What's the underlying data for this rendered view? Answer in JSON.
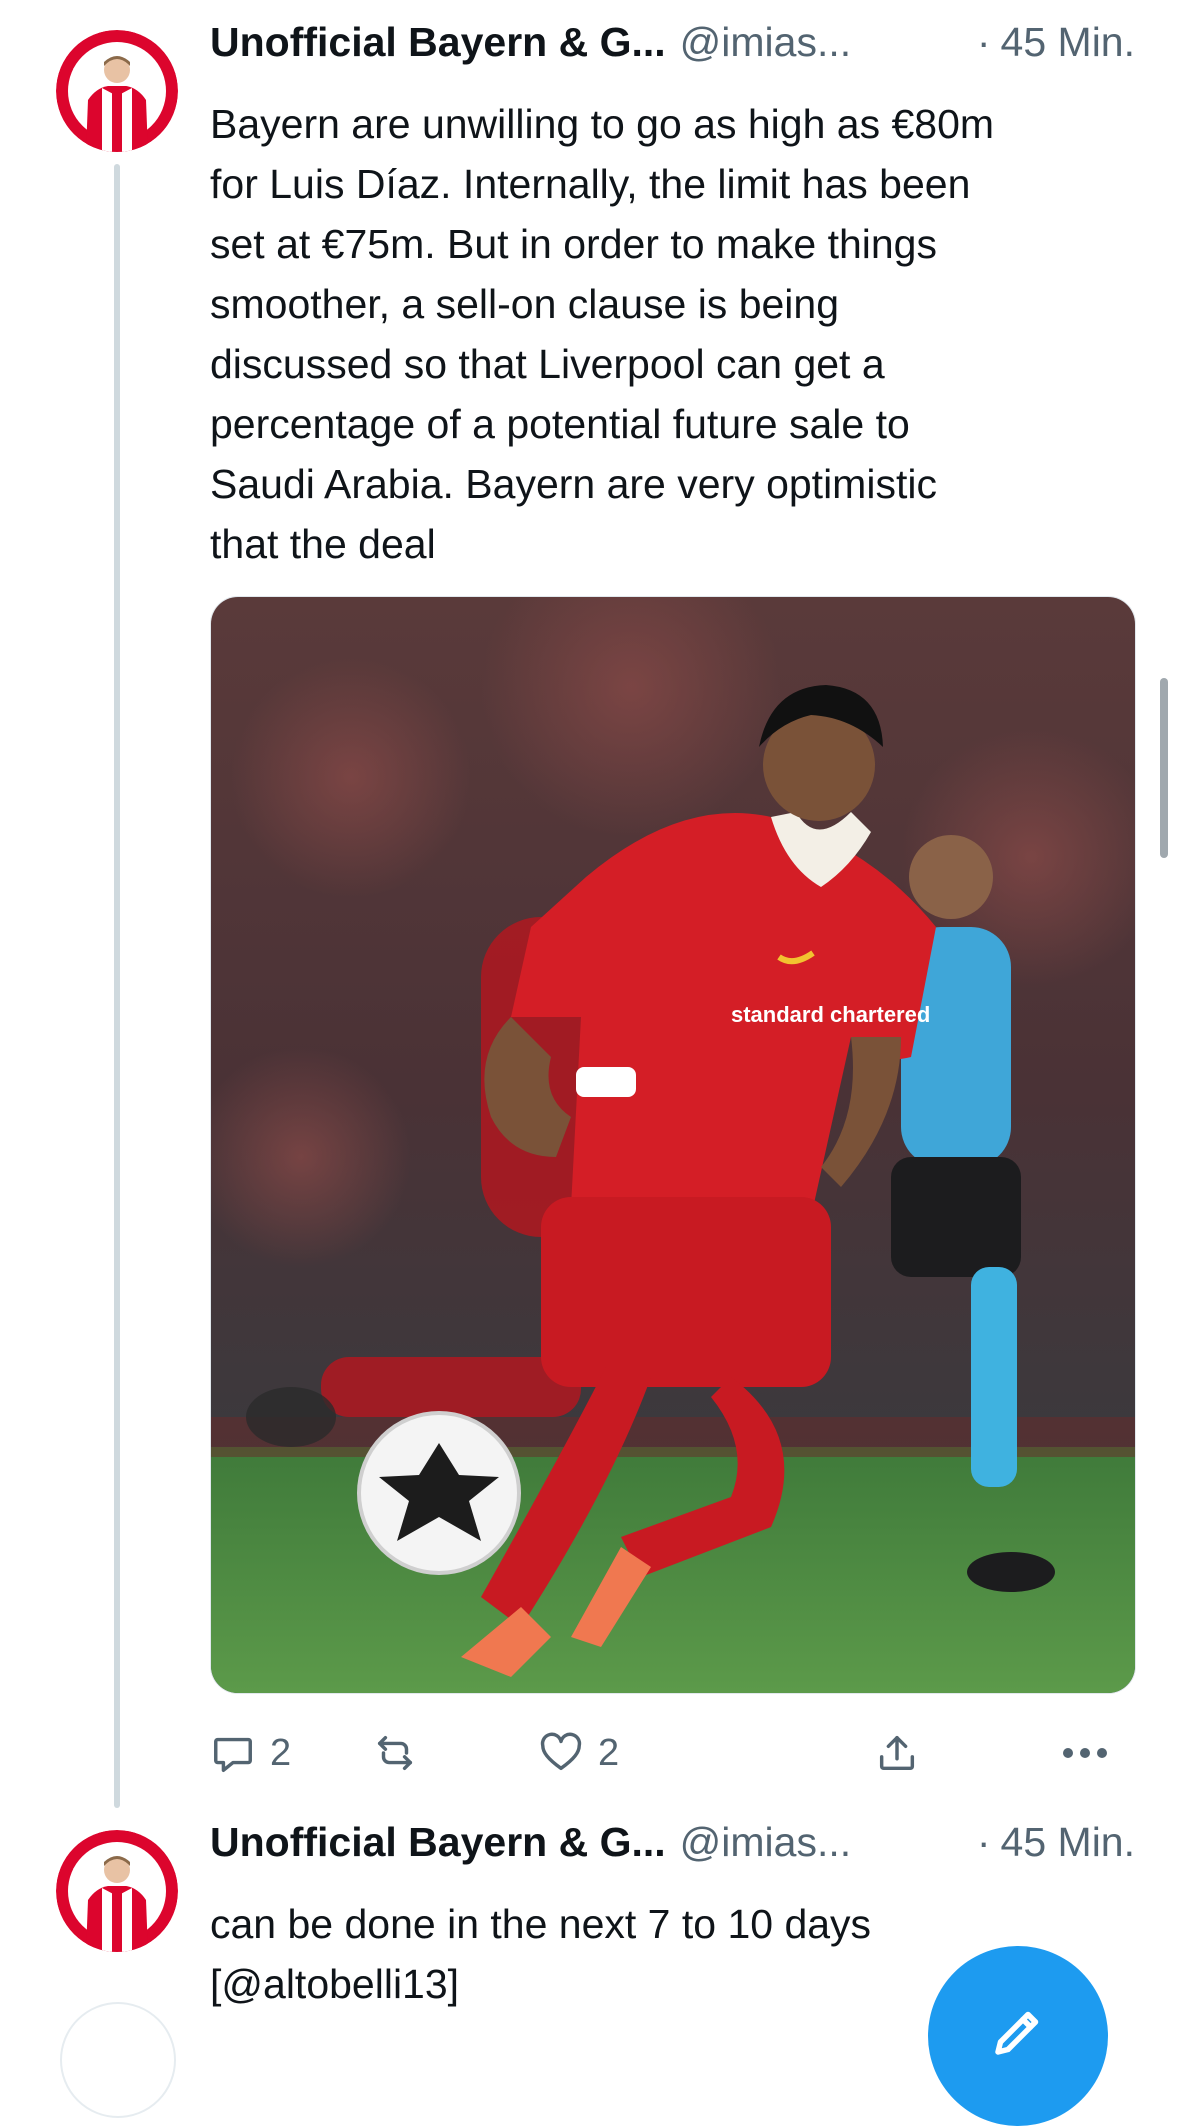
{
  "colors": {
    "text_primary": "#0f1419",
    "text_secondary": "#536471",
    "thread_line": "#cfd9de",
    "fab_blue": "#1d9bf0",
    "avatar_red": "#dc052d"
  },
  "tweets": [
    {
      "author_name": "Unofficial Bayern & G...",
      "handle": "@imias...",
      "separator": "·",
      "time": "45 Min.",
      "text": "Bayern are unwilling to go as high as €80m\nfor Luis Díaz. Internally, the limit has been\nset at €75m. But in order to make things\nsmoother, a sell-on clause is being\ndiscussed so that Liverpool can get a\npercentage of a potential future sale to\nSaudi Arabia. Bayern are very optimistic\nthat the deal",
      "media": {
        "type": "photo",
        "shirt_sponsor_text": "standard chartered"
      },
      "actions": {
        "reply": {
          "icon": "reply-icon",
          "count": "2"
        },
        "retweet": {
          "icon": "retweet-icon",
          "count": ""
        },
        "like": {
          "icon": "heart-icon",
          "count": "2"
        },
        "share": {
          "icon": "share-icon"
        },
        "more": {
          "icon": "more-icon"
        }
      }
    },
    {
      "author_name": "Unofficial Bayern & G...",
      "handle": "@imias...",
      "separator": "·",
      "time": "45 Min.",
      "text": "can be done in the next 7 to 10 days\n[@altobelli13]"
    }
  ],
  "fab": {
    "icon": "compose-icon"
  }
}
